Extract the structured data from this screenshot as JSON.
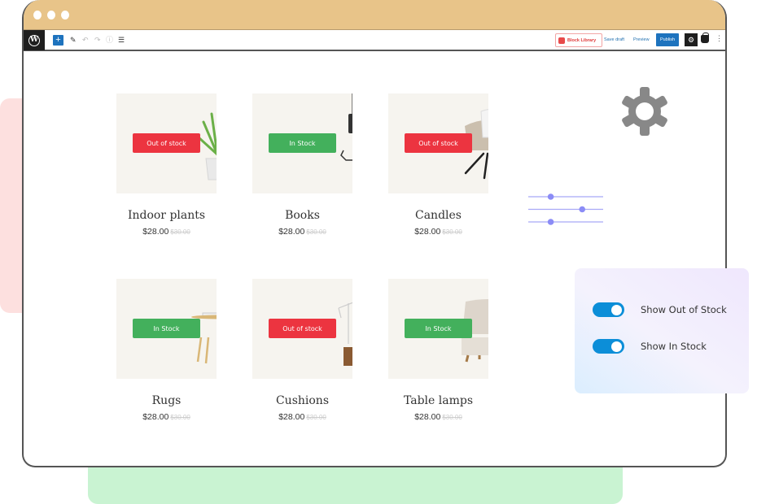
{
  "window": {
    "controls": [
      "close",
      "minimize",
      "maximize"
    ]
  },
  "toolbar": {
    "logo_letter": "W",
    "add_label": "+",
    "icons": {
      "edit": "✎",
      "undo": "↶",
      "redo": "↷",
      "info": "ⓘ",
      "list_view": "☰",
      "settings": "⚙",
      "more": "⋮"
    },
    "block_library_label": "Block Library",
    "save_draft_label": "Save draft",
    "preview_label": "Preview",
    "publish_label": "Publish"
  },
  "products": [
    {
      "name": "Indoor plants",
      "price": "$28.00",
      "old_price": "$30.00",
      "status": "Out of stock",
      "in_stock": false
    },
    {
      "name": "Books",
      "price": "$28.00",
      "old_price": "$30.00",
      "status": "In Stock",
      "in_stock": true
    },
    {
      "name": "Candles",
      "price": "$28.00",
      "old_price": "$30.00",
      "status": "Out of stock",
      "in_stock": false
    },
    {
      "name": "Rugs",
      "price": "$28.00",
      "old_price": "$30.00",
      "status": "In Stock",
      "in_stock": true
    },
    {
      "name": "Cushions",
      "price": "$28.00",
      "old_price": "$30.00",
      "status": "Out of stock",
      "in_stock": false
    },
    {
      "name": "Table lamps",
      "price": "$28.00",
      "old_price": "$30.00",
      "status": "In Stock",
      "in_stock": true
    }
  ],
  "sliders": [
    {
      "value": 0.3
    },
    {
      "value": 0.72
    },
    {
      "value": 0.3
    }
  ],
  "toggles": [
    {
      "label": "Show Out of Stock",
      "on": true
    },
    {
      "label": "Show In Stock",
      "on": true
    }
  ],
  "colors": {
    "out_of_stock": "#ec3440",
    "in_stock": "#43b05c",
    "titlebar": "#e8c489",
    "accent": "#1e73be",
    "toggle": "#0c8ed8",
    "slider": "#8b8cf6",
    "gear": "#888888"
  }
}
